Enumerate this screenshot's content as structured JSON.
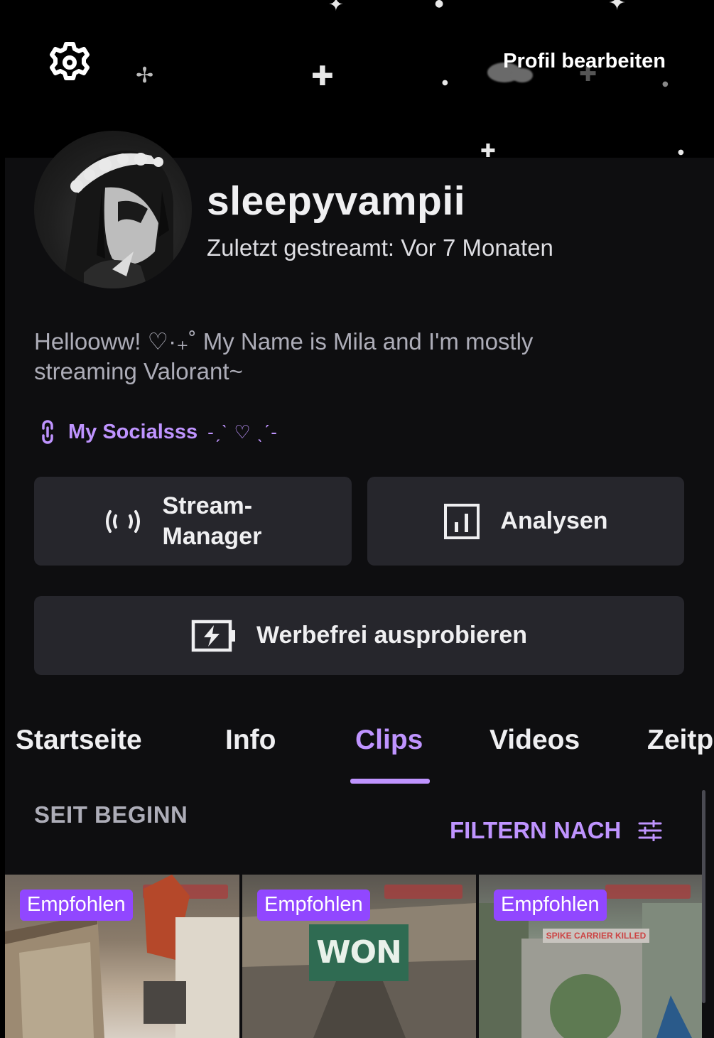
{
  "header": {
    "settings_icon": "gear-icon",
    "edit_profile_label": "Profil bearbeiten"
  },
  "profile": {
    "username": "sleepyvampii",
    "last_streamed": "Zuletzt gestreamt: Vor 7 Monaten",
    "bio": "Hellooww! ♡·₊˚ My Name is Mila and I'm mostly streaming Valorant~",
    "socials_label": "My Socialsss",
    "socials_deco": "-ˏˋ ♡ ˎˊ-"
  },
  "actions": {
    "stream_manager_label": "Stream-Manager",
    "analytics_label": "Analysen",
    "ad_free_label": "Werbefrei ausprobieren"
  },
  "tabs": [
    {
      "label": "Startseite",
      "active": false
    },
    {
      "label": "Info",
      "active": false
    },
    {
      "label": "Clips",
      "active": true
    },
    {
      "label": "Videos",
      "active": false
    },
    {
      "label": "Zeitp",
      "active": false
    }
  ],
  "clips_section": {
    "period_label": "SEIT BEGINN",
    "filter_label": "FILTERN NACH"
  },
  "clips": [
    {
      "badge": "Empfohlen"
    },
    {
      "badge": "Empfohlen",
      "overlay_text": "WON"
    },
    {
      "badge": "Empfohlen",
      "overlay_text": "SPIKE CARRIER KILLED"
    }
  ],
  "colors": {
    "accent": "#bf94ff",
    "badge": "#9147ff",
    "button_bg": "#26262c",
    "panel_bg": "#0e0e10"
  }
}
